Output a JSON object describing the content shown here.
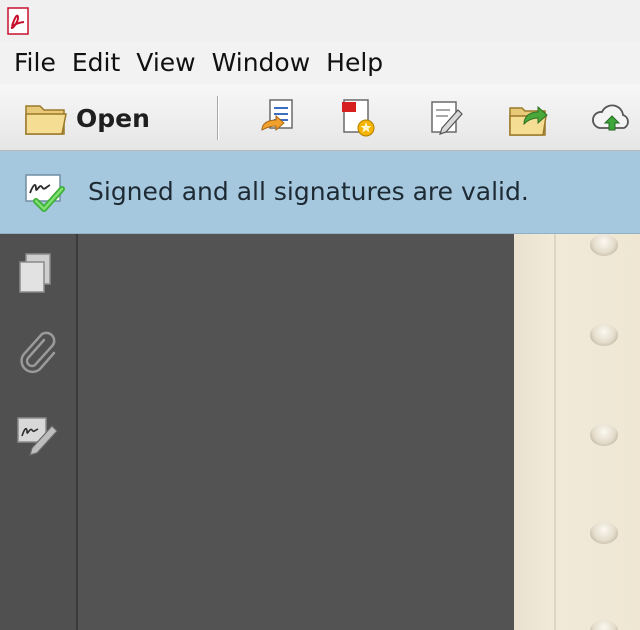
{
  "app": {
    "icon": "adobe-reader-pdf-icon",
    "accent": "#c8102e"
  },
  "menu": {
    "items": [
      "File",
      "Edit",
      "View",
      "Window",
      "Help"
    ]
  },
  "toolbar": {
    "open_label": "Open",
    "icons": [
      "document-convert-icon",
      "create-pdf-icon",
      "edit-pdf-icon",
      "export-pdf-icon",
      "cloud-upload-icon"
    ]
  },
  "signature_bar": {
    "message": "Signed and all signatures are valid.",
    "icon": "signature-valid-icon",
    "background": "#a6c8df"
  },
  "left_nav": {
    "icons": [
      "page-thumbnails-icon",
      "attachments-paperclip-icon",
      "signatures-panel-icon"
    ]
  },
  "document": {
    "description_color": "#efe7d4"
  }
}
